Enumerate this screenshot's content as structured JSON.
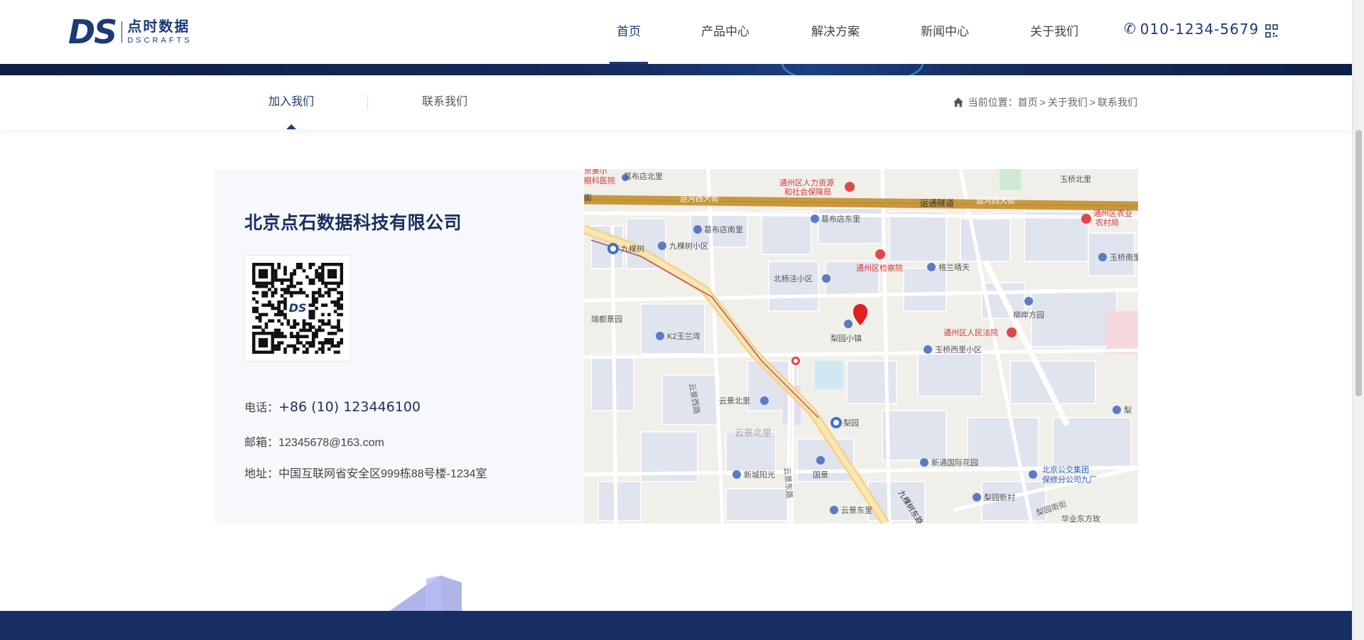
{
  "header": {
    "logo_mark": "DS",
    "logo_cn": "点时数据",
    "logo_en": "DSCRAFTS",
    "nav": [
      {
        "label": "首页",
        "active": true
      },
      {
        "label": "产品中心",
        "active": false
      },
      {
        "label": "解决方案",
        "active": false
      },
      {
        "label": "新闻中心",
        "active": false
      },
      {
        "label": "关于我们",
        "active": false
      }
    ],
    "phone_icon": "phone-icon",
    "phone": "010-1234-5679",
    "qr_icon": "qrcode-icon"
  },
  "subnav": {
    "tabs": [
      {
        "label": "加入我们",
        "active": true
      },
      {
        "label": "联系我们",
        "active": false
      }
    ],
    "breadcrumb": {
      "prefix": "当前位置：",
      "items": [
        "首页",
        "关于我们",
        "联系我们"
      ],
      "separator": ">"
    }
  },
  "contact": {
    "company": "北京点石数据科技有限公司",
    "qr_center": "DS",
    "phone_label": "电话：",
    "phone_value": "+86 (10) 123446100",
    "email_label": "邮箱：",
    "email_value": "12345678@163.com",
    "address_label": "地址：",
    "address_value": "中国互联网省安全区999栋88号楼-1234室"
  },
  "map": {
    "labels": {
      "yunhe_w": "运河西大街",
      "yuntong": "运通隧道",
      "jiukeshu": "九棵树",
      "jiukeshu_xq": "九棵树小区",
      "gebu_s": "葛布店南里",
      "gebu_e": "葛布店东里",
      "gebu_n": "葛布店北里",
      "hr_1": "通州区人力资源",
      "hr_2": "和社会保障局",
      "court": "通州区人民法院",
      "procuratorate": "通州区检察院",
      "gelan": "格兰晴天",
      "beiyang": "北杨洼小区",
      "liyuan_town": "梨园小镇",
      "liuan": "柳岸方园",
      "yuqiao_w": "玉桥西里小区",
      "yuqiao_n": "玉桥北里",
      "yuqiao_s": "玉桥南里",
      "ruidu": "瑞都景园",
      "k2": "K2玉兰湾",
      "yunjing_n": "云景北里",
      "yunjing_w_road": "云景西路",
      "yunjing_e_road": "云景东路",
      "yunjing_e": "云景东里",
      "liyuan_st": "梨园",
      "xincheng": "新城阳光",
      "guojing": "国景",
      "xintong": "新通国际花园",
      "bus_1": "北京公交集团",
      "bus_2": "保修分公司九厂",
      "liyuan_xc": "梨园新村",
      "liyuan_nj": "梨园南街",
      "huaye": "华业东方玫",
      "jiuke_road": "九棵树东路",
      "meier_1": "京美尔",
      "meier_2": "眼科医院",
      "agri_1": "通州区农业",
      "agri_2": "农村局",
      "jie": "街",
      "li_right": "梨"
    }
  },
  "colors": {
    "brand": "#1a3a7a",
    "dark_navy": "#172e63",
    "card_bg": "#f6f8fc",
    "map_road_major": "#c8983c",
    "map_marker": "#e02020"
  }
}
